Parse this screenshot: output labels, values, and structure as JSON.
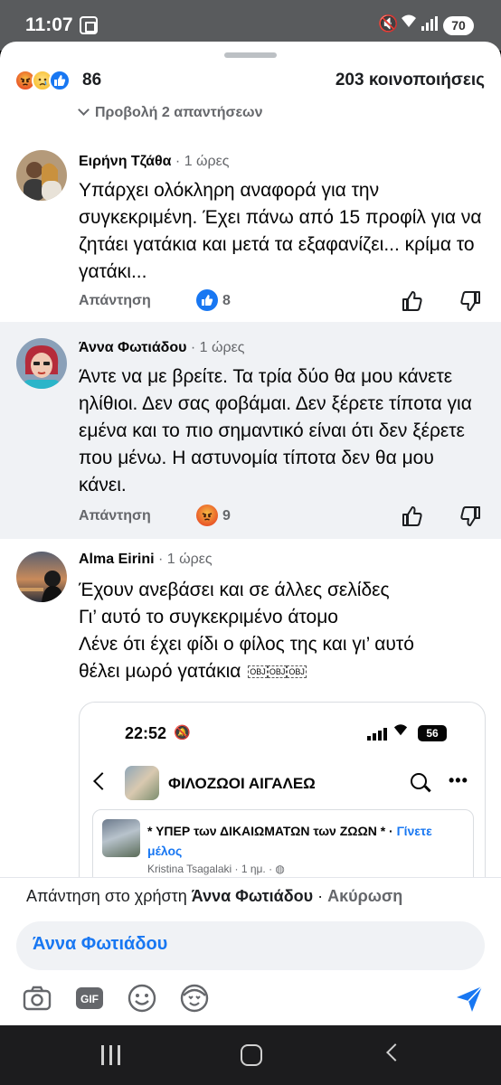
{
  "status_bar": {
    "time": "11:07",
    "battery": "70"
  },
  "post_summary": {
    "reaction_icons": [
      "angry-icon",
      "sad-icon",
      "like-icon"
    ],
    "reaction_count": "86",
    "shares": "203 κοινοποιήσεις"
  },
  "view_replies": "Προβολή 2 απαντήσεων",
  "comments": [
    {
      "author": "Ειρήνη Τζάθα",
      "time": "· 1 ώρες",
      "text": "Υπάρχει ολόκληρη αναφορά για την συγκεκριμένη. Έχει πάνω από 15 προφίλ για να ζητάει γατάκια και μετά τα εξαφανίζει... κρίμα το γατάκι...",
      "reply_label": "Απάντηση",
      "reaction_icon": "like-icon",
      "reaction_count": "8"
    },
    {
      "author": "Άννα Φωτιάδου",
      "time": "· 1 ώρες",
      "text": "Άντε να με βρείτε. Τα τρία δύο θα μου κάνετε ηλίθιοι. Δεν σας φοβάμαι. Δεν ξέρετε τίποτα για εμένα και το πιο σημαντικό είναι ότι δεν ξέρετε που μένω. Η αστυνομία τίποτα δεν θα μου κάνει.",
      "reply_label": "Απάντηση",
      "reaction_icon": "angry-icon",
      "reaction_count": "9"
    },
    {
      "author": "Alma Eirini",
      "time": "· 1 ώρες",
      "text_lines": [
        "Έχουν ανεβάσει και σε άλλες σελίδες",
        "Γι’ αυτό το συγκεκριμένο άτομο",
        "Λένε ότι έχει φίδι ο φίλος της και γι’ αυτό",
        "θέλει μωρό γατάκια"
      ],
      "obj_marker": "OBJ",
      "embedded_screenshot": {
        "time": "22:52",
        "battery": "56",
        "group_name": "ΦΙΛΟΖΩΟΙ ΑΙΓΑΛΕΩ",
        "post_title": "* ΥΠΕΡ των ΔΙΚΑΙΩΜΑΤΩΝ των ΖΩΩΝ * ·",
        "join_label": "Γίνετε μέλος",
        "post_meta": "Kristina Tsagalaki · 1 ημ. · ◍"
      }
    }
  ],
  "composer": {
    "replying_prefix": "Απάντηση στο χρήστη ",
    "replying_to": "Άννα Φωτιάδου",
    "separator": " · ",
    "cancel_label": "Ακύρωση",
    "input_value": "Άννα Φωτιάδου",
    "tools": [
      "camera-icon",
      "gif-icon",
      "emoji-icon",
      "avatar-sticker-icon"
    ],
    "gif_label": "GIF"
  },
  "colors": {
    "accent": "#1877f2",
    "secondary_text": "#65676b",
    "highlight_bg": "#f0f2f5"
  }
}
